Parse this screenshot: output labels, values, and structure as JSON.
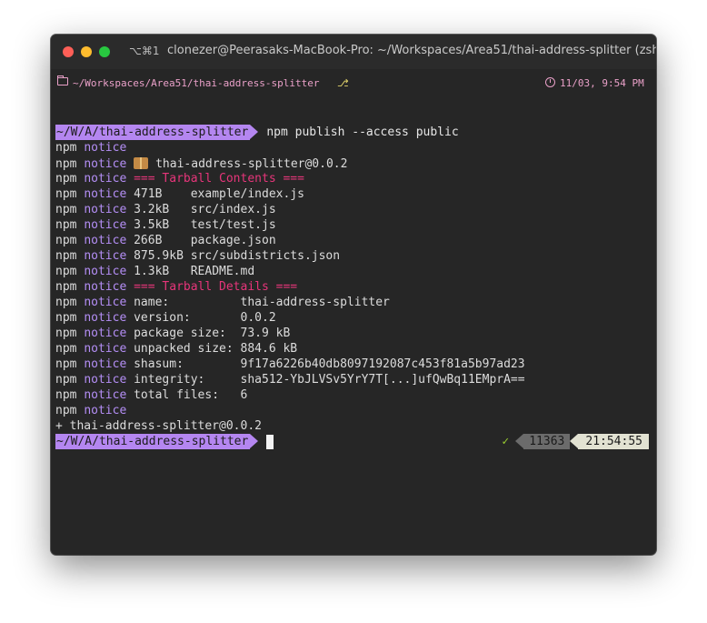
{
  "titlebar": {
    "shortcut": "⌥⌘1",
    "title": "clonezer@Peerasaks-MacBook-Pro: ~/Workspaces/Area51/thai-address-splitter (zsh)"
  },
  "status": {
    "cwd": "~/Workspaces/Area51/thai-address-splitter",
    "branch_icon": "⎇",
    "datetime": "11/03, 9:54 PM"
  },
  "prompt": {
    "path": "~/W/A/thai-address-splitter",
    "command": "npm publish --access public"
  },
  "output": [
    {
      "npm": "npm",
      "level": "notice",
      "text": ""
    },
    {
      "npm": "npm",
      "level": "notice",
      "icon": "package",
      "text": "thai-address-splitter@0.0.2"
    },
    {
      "npm": "npm",
      "level": "notice",
      "head": "=== Tarball Contents ==="
    },
    {
      "npm": "npm",
      "level": "notice",
      "text": "471B    example/index.js"
    },
    {
      "npm": "npm",
      "level": "notice",
      "text": "3.2kB   src/index.js"
    },
    {
      "npm": "npm",
      "level": "notice",
      "text": "3.5kB   test/test.js"
    },
    {
      "npm": "npm",
      "level": "notice",
      "text": "266B    package.json"
    },
    {
      "npm": "npm",
      "level": "notice",
      "text": "875.9kB src/subdistricts.json"
    },
    {
      "npm": "npm",
      "level": "notice",
      "text": "1.3kB   README.md"
    },
    {
      "npm": "npm",
      "level": "notice",
      "head": "=== Tarball Details ==="
    },
    {
      "npm": "npm",
      "level": "notice",
      "text": "name:          thai-address-splitter"
    },
    {
      "npm": "npm",
      "level": "notice",
      "text": "version:       0.0.2"
    },
    {
      "npm": "npm",
      "level": "notice",
      "text": "package size:  73.9 kB"
    },
    {
      "npm": "npm",
      "level": "notice",
      "text": "unpacked size: 884.6 kB"
    },
    {
      "npm": "npm",
      "level": "notice",
      "text": "shasum:        9f17a6226b40db8097192087c453f81a5b97ad23"
    },
    {
      "npm": "npm",
      "level": "notice",
      "text": "integrity:     sha512-YbJLVSv5YrY7T[...]ufQwBq11EMprA=="
    },
    {
      "npm": "npm",
      "level": "notice",
      "text": "total files:   6"
    },
    {
      "npm": "npm",
      "level": "notice",
      "text": ""
    }
  ],
  "published": "+ thai-address-splitter@0.0.2",
  "right_prompt": {
    "check": "✓",
    "history": "11363",
    "clock": "21:54:55"
  },
  "colors": {
    "prompt_bg": "#b486f0",
    "notice": "#b48ef5",
    "heading": "#e6357a",
    "status": "#e9a0c8"
  }
}
